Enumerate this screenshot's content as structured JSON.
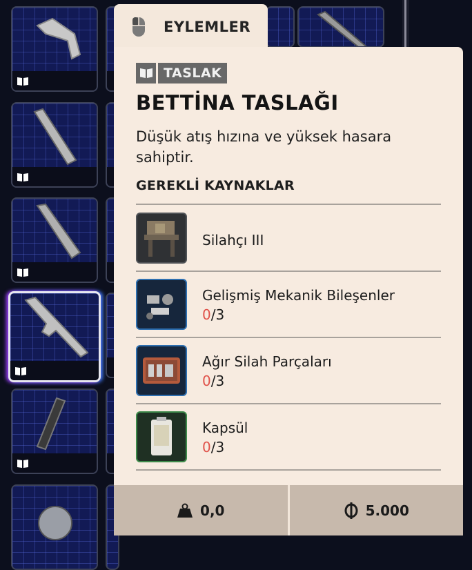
{
  "actions_tab": {
    "label": "EYLEMLER",
    "icon": "mouse-icon"
  },
  "tooltip": {
    "tag": {
      "icon": "book-icon",
      "label": "TASLAK"
    },
    "title": "BETTİNA TASLAĞI",
    "description": "Düşük atış hızına ve yüksek hasara sahiptir.",
    "requirements_title": "GEREKLİ KAYNAKLAR",
    "requirements": [
      {
        "name": "Silahçı III",
        "rarity_color": "#505357",
        "have": "",
        "sep": "",
        "need": ""
      },
      {
        "name": "Gelişmiş Mekanik Bileşenler",
        "rarity_color": "#2e6fb0",
        "have": "0",
        "sep": "/",
        "need": "3"
      },
      {
        "name": "Ağır Silah Parçaları",
        "rarity_color": "#2e6fb0",
        "have": "0",
        "sep": "/",
        "need": "3"
      },
      {
        "name": "Kapsül",
        "rarity_color": "#3d8a4a",
        "have": "0",
        "sep": "/",
        "need": "3"
      }
    ]
  },
  "footer": {
    "weight": {
      "icon": "weight-icon",
      "value": "0,0"
    },
    "price": {
      "icon": "currency-icon",
      "value": "5.000"
    }
  },
  "colors": {
    "panel_bg": "#f7ebe0",
    "missing_count": "#e0524a",
    "grid_slot": "#121a55"
  }
}
